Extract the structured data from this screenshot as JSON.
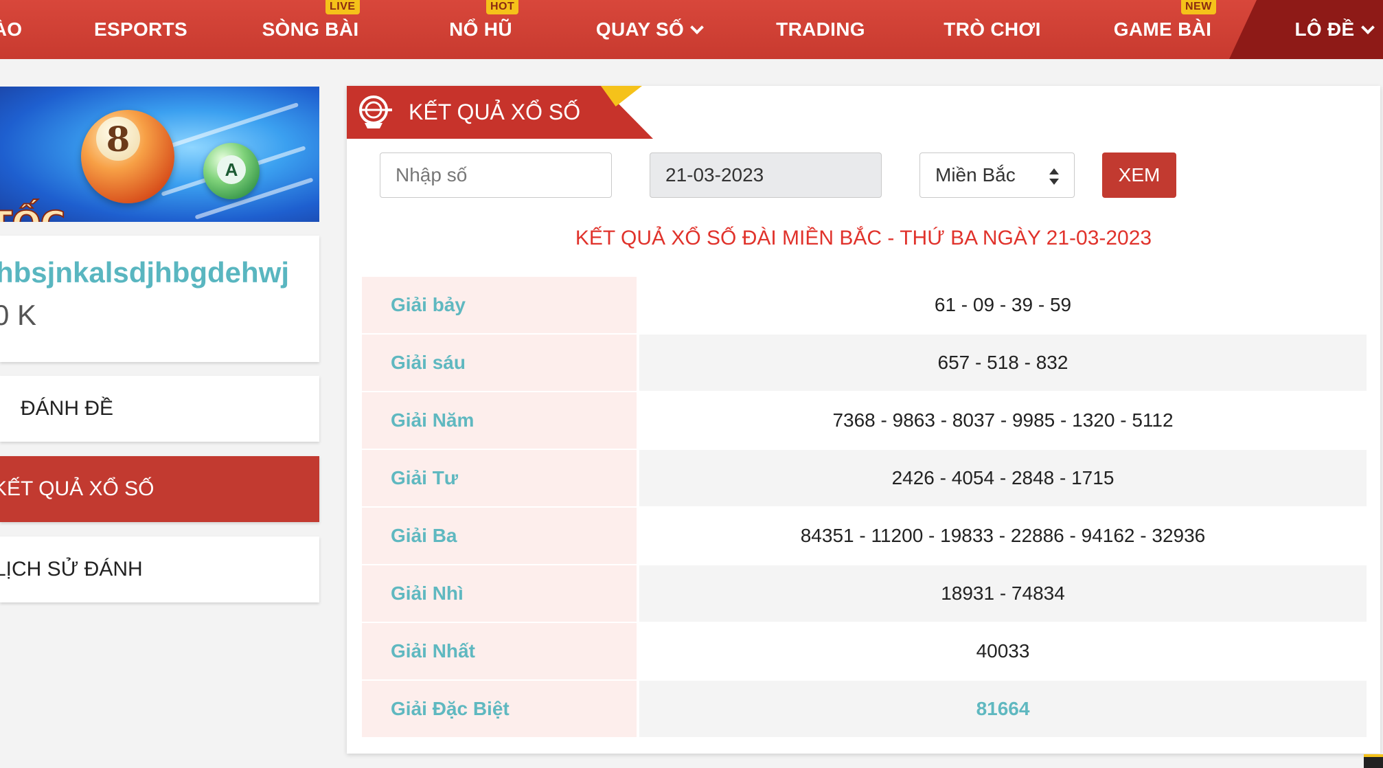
{
  "nav": {
    "items": [
      {
        "label": "ÀO"
      },
      {
        "label": "ESPORTS"
      },
      {
        "label": "SÒNG BÀI",
        "badge": "LIVE"
      },
      {
        "label": "NỔ HŨ",
        "badge": "HOT"
      },
      {
        "label": "QUAY SỐ"
      },
      {
        "label": "TRADING"
      },
      {
        "label": "TRÒ CHƠI"
      },
      {
        "label": "GAME BÀI",
        "badge": "NEW"
      },
      {
        "label": "LÔ ĐỀ"
      }
    ]
  },
  "sidebar": {
    "banner_text": "TỐC",
    "ball_big": "8",
    "ball_small": "A",
    "username": "hbsjnkalsdjhbgdehwj",
    "balance": "0 K",
    "menu": [
      {
        "label": "ĐÁNH ĐỀ"
      },
      {
        "label": "KẾT QUẢ XỔ SỐ",
        "active": true
      },
      {
        "label": "LỊCH SỬ ĐÁNH"
      }
    ]
  },
  "panel": {
    "title": "KẾT QUẢ XỔ SỐ",
    "number_placeholder": "Nhập số",
    "date": "21-03-2023",
    "region": "Miền Bắc",
    "button": "XEM",
    "result_heading": "KẾT QUẢ XỔ SỐ ĐÀI MIỀN BẮC - THỨ BA NGÀY 21-03-2023",
    "results": [
      {
        "prize": "Giải bảy",
        "numbers": "61 - 09 - 39 - 59"
      },
      {
        "prize": "Giải sáu",
        "numbers": "657 - 518 - 832"
      },
      {
        "prize": "Giải Năm",
        "numbers": "7368 - 9863 - 8037 - 9985 - 1320 - 5112"
      },
      {
        "prize": "Giải Tư",
        "numbers": "2426 - 4054 - 2848 - 1715"
      },
      {
        "prize": "Giải Ba",
        "numbers": "84351 - 11200 - 19833 - 22886 - 94162 - 32936"
      },
      {
        "prize": "Giải Nhì",
        "numbers": "18931 - 74834"
      },
      {
        "prize": "Giải Nhất",
        "numbers": "40033"
      },
      {
        "prize": "Giải Đặc Biệt",
        "numbers": "81664"
      }
    ]
  },
  "colors": {
    "nav_red": "#c83a2f",
    "nav_dark": "#8e1a17",
    "accent_red": "#c23a30",
    "heading_red": "#e0322b",
    "teal": "#5fb8c0",
    "badge_yellow": "#f5c21a"
  }
}
